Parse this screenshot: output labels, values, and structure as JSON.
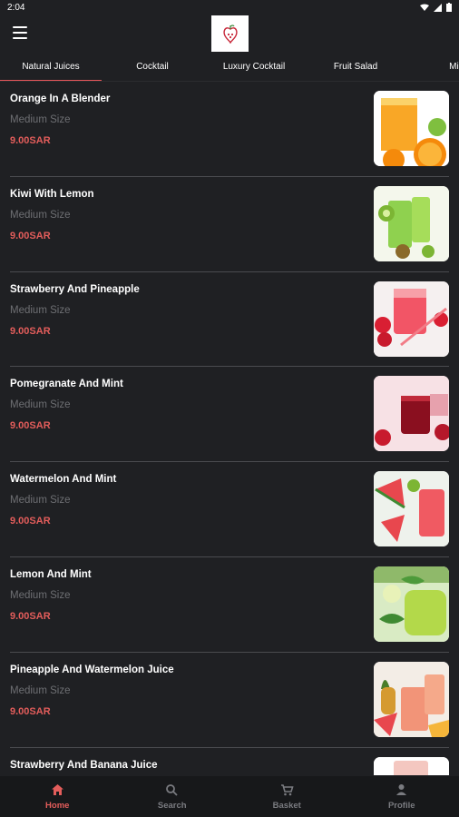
{
  "status": {
    "time": "2:04"
  },
  "tabs": [
    {
      "label": "Natural Juices",
      "active": true
    },
    {
      "label": "Cocktail",
      "active": false
    },
    {
      "label": "Luxury Cocktail",
      "active": false
    },
    {
      "label": "Fruit Salad",
      "active": false
    },
    {
      "label": "Milk",
      "active": false
    }
  ],
  "products": [
    {
      "name": "Orange In A Blender",
      "size": "Medium Size",
      "price": "9.00SAR",
      "image": "orange-juice"
    },
    {
      "name": "Kiwi With Lemon",
      "size": "Medium Size",
      "price": "9.00SAR",
      "image": "kiwi-lemon-juice"
    },
    {
      "name": "Strawberry And Pineapple",
      "size": "Medium Size",
      "price": "9.00SAR",
      "image": "strawberry-pineapple-juice"
    },
    {
      "name": "Pomegranate And Mint",
      "size": "Medium Size",
      "price": "9.00SAR",
      "image": "pomegranate-mint-juice"
    },
    {
      "name": "Watermelon And Mint",
      "size": "Medium Size",
      "price": "9.00SAR",
      "image": "watermelon-mint-juice"
    },
    {
      "name": "Lemon And Mint",
      "size": "Medium Size",
      "price": "9.00SAR",
      "image": "lemon-mint-juice"
    },
    {
      "name": "Pineapple And Watermelon Juice",
      "size": "Medium Size",
      "price": "9.00SAR",
      "image": "pineapple-watermelon-juice"
    },
    {
      "name": "Strawberry And Banana Juice",
      "size": "",
      "price": "",
      "image": "strawberry-banana-juice"
    }
  ],
  "nav": [
    {
      "label": "Home",
      "icon": "home-icon",
      "active": true
    },
    {
      "label": "Search",
      "icon": "search-icon",
      "active": false
    },
    {
      "label": "Basket",
      "icon": "cart-icon",
      "active": false
    },
    {
      "label": "Profile",
      "icon": "profile-icon",
      "active": false
    }
  ],
  "colors": {
    "accent": "#e35d5b",
    "background": "#1f2023",
    "nav_background": "#17181a"
  }
}
